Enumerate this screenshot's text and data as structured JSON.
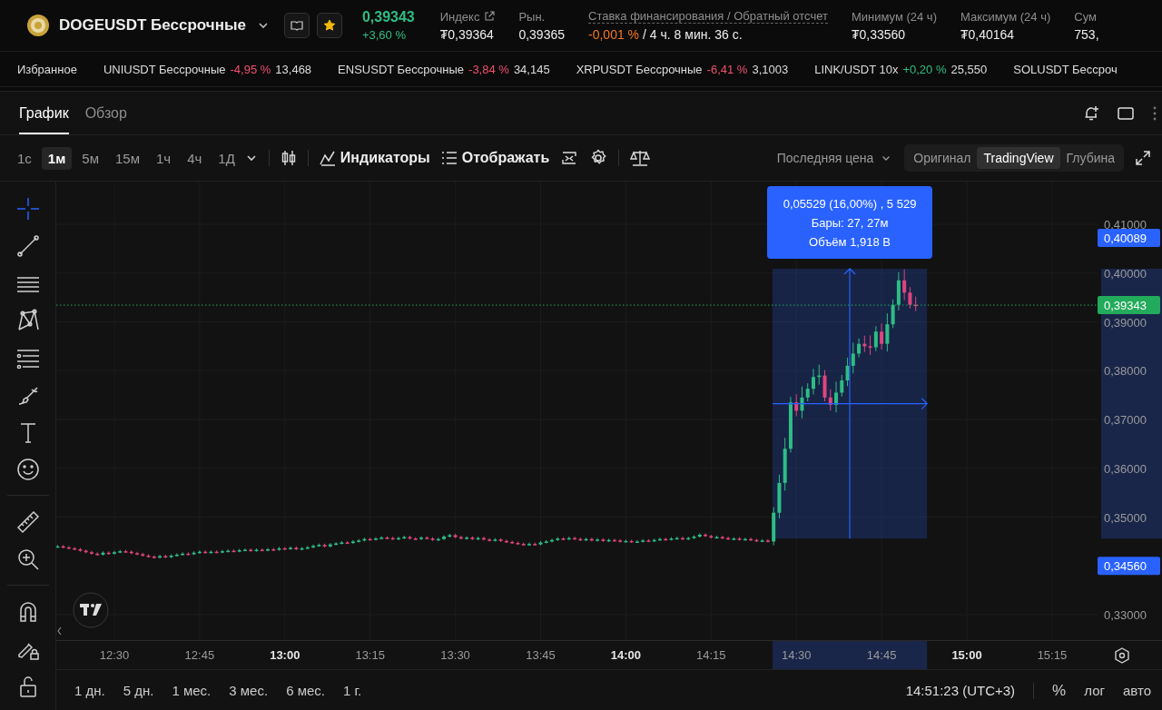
{
  "header": {
    "symbol": "DOGEUSDT Бессрочные",
    "favorite": true,
    "price": "0,39343",
    "change": "+3,60 %",
    "stats": [
      {
        "kind": "link",
        "label": "Индекс",
        "value": "₮0,39364"
      },
      {
        "kind": "plain",
        "label": "Рын.",
        "value": "0,39365"
      },
      {
        "kind": "funding",
        "label": "Ставка финансирования / Обратный отсчет",
        "rate": "-0,001 %",
        "countdown": "/ 4 ч. 8 мин. 36 с."
      },
      {
        "kind": "plain",
        "label": "Минимум (24 ч)",
        "value": "₮0,33560"
      },
      {
        "kind": "plain",
        "label": "Максимум (24 ч)",
        "value": "₮0,40164"
      },
      {
        "kind": "plain",
        "label": "Сум",
        "value": "753,"
      }
    ]
  },
  "ticker": {
    "label": "Избранное",
    "items": [
      {
        "name": "UNIUSDT Бессрочные",
        "change": "-4,95 %",
        "color": "#f0506e",
        "value": "13,468"
      },
      {
        "name": "ENSUSDT Бессрочные",
        "change": "-3,84 %",
        "color": "#f0506e",
        "value": "34,145"
      },
      {
        "name": "XRPUSDT Бессрочные",
        "change": "-6,41 %",
        "color": "#f0506e",
        "value": "3,1003"
      },
      {
        "name": "LINK/USDT 10x",
        "change": "+0,20 %",
        "color": "#2ebd85",
        "value": "25,550"
      },
      {
        "name": "SOLUSDT Бессроч"
      }
    ]
  },
  "tabs": [
    {
      "label": "График",
      "selected": true
    },
    {
      "label": "Обзор",
      "selected": false
    }
  ],
  "intervals": [
    {
      "label": "1с",
      "selected": false
    },
    {
      "label": "1м",
      "selected": true
    },
    {
      "label": "5м",
      "selected": false
    },
    {
      "label": "15м",
      "selected": false
    },
    {
      "label": "1ч",
      "selected": false
    },
    {
      "label": "4ч",
      "selected": false
    },
    {
      "label": "1Д",
      "selected": false
    }
  ],
  "toolbar": {
    "indicators": "Индикаторы",
    "display": "Отображать",
    "price_source": "Последняя цена",
    "views": [
      {
        "label": "Оригинал",
        "selected": false
      },
      {
        "label": "TradingView",
        "selected": true
      },
      {
        "label": "Глубина",
        "selected": false
      }
    ]
  },
  "tools": [
    {
      "kind": "crosshair",
      "selected": true
    },
    {
      "kind": "trend-line",
      "selected": false
    },
    {
      "kind": "horizontal-lines",
      "selected": false
    },
    {
      "kind": "pattern",
      "selected": false
    },
    {
      "kind": "fib",
      "selected": false
    },
    {
      "kind": "brush",
      "selected": false
    },
    {
      "kind": "text",
      "selected": false
    },
    {
      "kind": "emoji",
      "selected": false,
      "divider_after": true
    },
    {
      "kind": "ruler",
      "selected": false
    },
    {
      "kind": "zoom",
      "selected": false,
      "divider_after": true
    },
    {
      "kind": "magnet",
      "selected": false
    },
    {
      "kind": "draw-lock",
      "selected": false
    },
    {
      "kind": "lock",
      "selected": false
    }
  ],
  "chart": {
    "y_axis": [
      {
        "label": "0,41000"
      },
      {
        "label": "0,40000"
      },
      {
        "label": "0,39000"
      },
      {
        "label": "0,38000"
      },
      {
        "label": "0,37000"
      },
      {
        "label": "0,36000"
      },
      {
        "label": "0,35000"
      },
      {
        "label": "0,33000",
        "gap_before": true
      }
    ],
    "x_axis": [
      {
        "label": "12:30",
        "major": false
      },
      {
        "label": "12:45",
        "major": false
      },
      {
        "label": "13:00",
        "major": true
      },
      {
        "label": "13:15",
        "major": false
      },
      {
        "label": "13:30",
        "major": false
      },
      {
        "label": "13:45",
        "major": false
      },
      {
        "label": "14:00",
        "major": true
      },
      {
        "label": "14:15",
        "major": false
      },
      {
        "label": "14:30",
        "major": false
      },
      {
        "label": "14:45",
        "major": false
      },
      {
        "label": "15:00",
        "major": true
      },
      {
        "label": "15:15",
        "major": false
      }
    ],
    "last_price": "0,39343",
    "measure": {
      "top_label": "0,40089",
      "bottom_label": "0,34560",
      "lines": [
        "0,05529 (16,00%) , 5 529",
        "Бары: 27, 27м",
        "Объём 1,918 B"
      ]
    }
  },
  "ranges": [
    "1 дн.",
    "5 дн.",
    "1 мес.",
    "3 мес.",
    "6 мес.",
    "1 г."
  ],
  "footer": {
    "time": "14:51:23 (UTC+3)",
    "percent": "%",
    "log": "лог",
    "auto": "авто"
  }
}
